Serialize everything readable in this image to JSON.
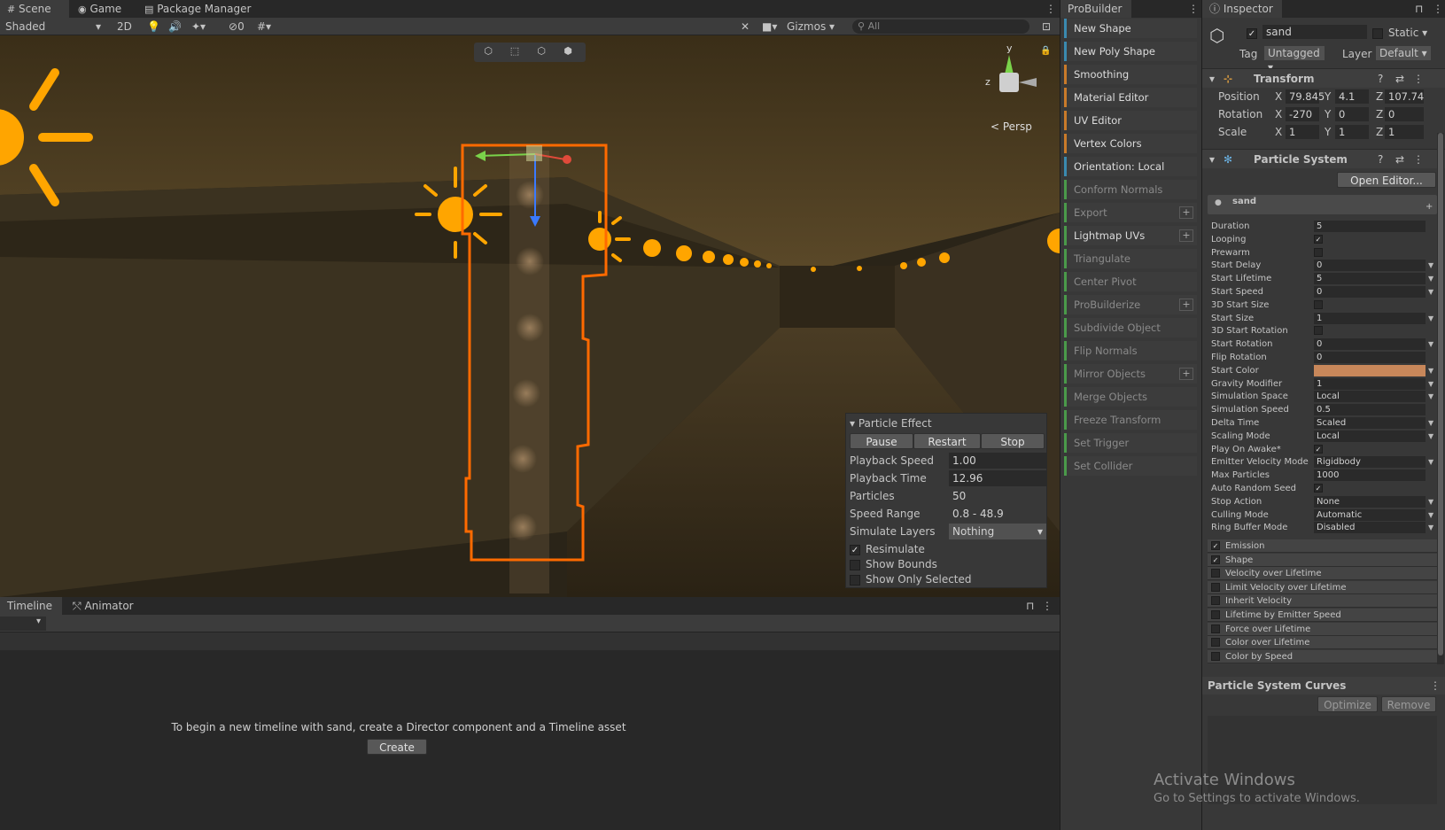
{
  "top_tabs": {
    "scene": "Scene",
    "game": "Game",
    "package_manager": "Package Manager",
    "probuilder": "ProBuilder",
    "inspector": "Inspector"
  },
  "scene_toolbar": {
    "shading": "Shaded",
    "mode_2d": "2D",
    "hidden_count": "0",
    "gizmos": "Gizmos",
    "search_placeholder": "All"
  },
  "gizmo": {
    "axis_y": "y",
    "axis_z": "z",
    "projection": "< Persp"
  },
  "particle_effect": {
    "title": "Particle Effect",
    "pause": "Pause",
    "restart": "Restart",
    "stop": "Stop",
    "rows": [
      {
        "label": "Playback Speed",
        "value": "1.00"
      },
      {
        "label": "Playback Time",
        "value": "12.96"
      },
      {
        "label": "Particles",
        "value": "50"
      },
      {
        "label": "Speed Range",
        "value": "0.8 - 48.9"
      },
      {
        "label": "Simulate Layers",
        "value": "Nothing"
      }
    ],
    "checks": [
      {
        "label": "Resimulate",
        "checked": true
      },
      {
        "label": "Show Bounds",
        "checked": false
      },
      {
        "label": "Show Only Selected",
        "checked": false
      }
    ]
  },
  "bottom": {
    "tab_timeline": "Timeline",
    "tab_animator": "Animator",
    "message": "To begin a new timeline with sand, create a Director component and a Timeline asset",
    "create": "Create"
  },
  "probuilder": {
    "items": [
      "New Shape",
      "New Poly Shape",
      "Smoothing",
      "Material Editor",
      "UV Editor",
      "Vertex Colors",
      "Orientation: Local",
      "Conform Normals",
      "Export",
      "Lightmap UVs",
      "Triangulate",
      "Center Pivot",
      "ProBuilderize",
      "Subdivide Object",
      "Flip Normals",
      "Mirror Objects",
      "Merge Objects",
      "Freeze Transform",
      "Set Trigger",
      "Set Collider"
    ]
  },
  "inspector": {
    "object_name": "sand",
    "static": "Static",
    "tag_label": "Tag",
    "tag_value": "Untagged",
    "layer_label": "Layer",
    "layer_value": "Default",
    "transform_title": "Transform",
    "position_label": "Position",
    "rotation_label": "Rotation",
    "scale_label": "Scale",
    "axis_x": "X",
    "axis_y": "Y",
    "axis_z": "Z",
    "position": {
      "x": "79.845",
      "y": "4.1",
      "z": "107.74"
    },
    "rotation": {
      "x": "-270",
      "y": "0",
      "z": "0"
    },
    "scale": {
      "x": "1",
      "y": "1",
      "z": "1"
    },
    "ps_title": "Particle System",
    "open_editor": "Open Editor...",
    "ps_name": "sand",
    "props": [
      {
        "label": "Duration",
        "value": "5"
      },
      {
        "label": "Looping",
        "value": "✓"
      },
      {
        "label": "Prewarm",
        "value": ""
      },
      {
        "label": "Start Delay",
        "value": "0"
      },
      {
        "label": "Start Lifetime",
        "value": "5"
      },
      {
        "label": "Start Speed",
        "value": "0"
      },
      {
        "label": "3D Start Size",
        "value": ""
      },
      {
        "label": "Start Size",
        "value": "1"
      },
      {
        "label": "3D Start Rotation",
        "value": ""
      },
      {
        "label": "Start Rotation",
        "value": "0"
      },
      {
        "label": "Flip Rotation",
        "value": "0"
      },
      {
        "label": "Start Color",
        "value": ""
      },
      {
        "label": "Gravity Modifier",
        "value": "1"
      },
      {
        "label": "Simulation Space",
        "value": "Local"
      },
      {
        "label": "Simulation Speed",
        "value": "0.5"
      },
      {
        "label": "Delta Time",
        "value": "Scaled"
      },
      {
        "label": "Scaling Mode",
        "value": "Local"
      },
      {
        "label": "Play On Awake*",
        "value": "✓"
      },
      {
        "label": "Emitter Velocity Mode",
        "value": "Rigidbody"
      },
      {
        "label": "Max Particles",
        "value": "1000"
      },
      {
        "label": "Auto Random Seed",
        "value": "✓"
      },
      {
        "label": "Stop Action",
        "value": "None"
      },
      {
        "label": "Culling Mode",
        "value": "Automatic"
      },
      {
        "label": "Ring Buffer Mode",
        "value": "Disabled"
      }
    ],
    "modules": [
      {
        "label": "Emission",
        "checked": true
      },
      {
        "label": "Shape",
        "checked": true
      },
      {
        "label": "Velocity over Lifetime",
        "checked": false
      },
      {
        "label": "Limit Velocity over Lifetime",
        "checked": false
      },
      {
        "label": "Inherit Velocity",
        "checked": false
      },
      {
        "label": "Lifetime by Emitter Speed",
        "checked": false
      },
      {
        "label": "Force over Lifetime",
        "checked": false
      },
      {
        "label": "Color over Lifetime",
        "checked": false
      },
      {
        "label": "Color by Speed",
        "checked": false
      }
    ],
    "curves_title": "Particle System Curves",
    "optimize": "Optimize",
    "remove": "Remove"
  },
  "watermark": {
    "line1": "Activate Windows",
    "line2": "Go to Settings to activate Windows."
  },
  "colors": {
    "selection_orange": "#ff6a00",
    "sun_orange": "#ffa500",
    "accent_blue": "#3a8ab0",
    "start_color": "#c8875a"
  }
}
